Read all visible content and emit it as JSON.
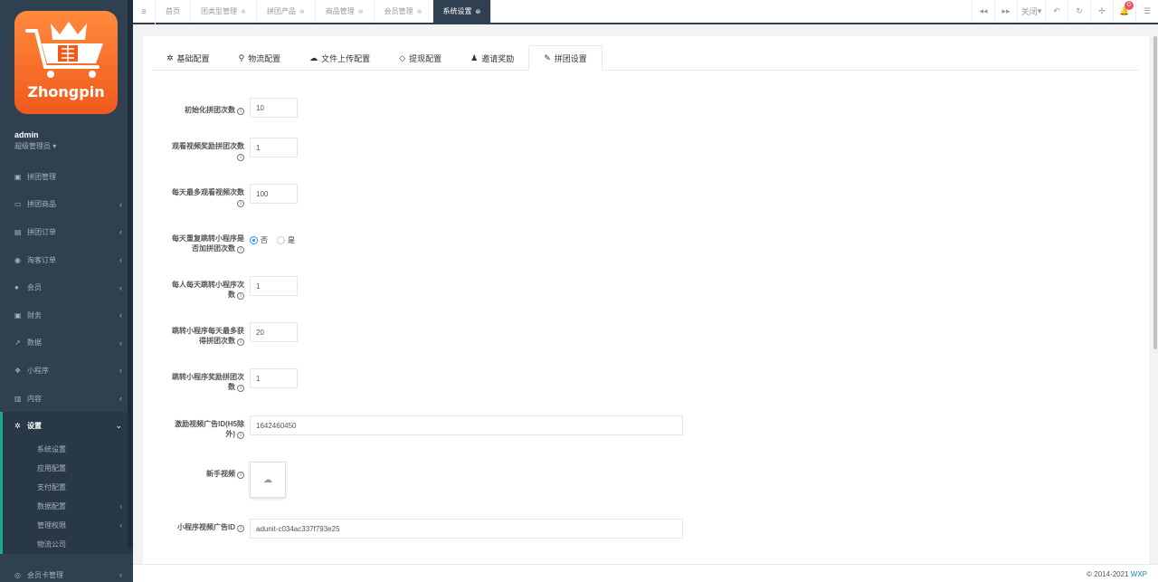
{
  "sidebar": {
    "logo_text": "Zhongpin",
    "user": {
      "name": "admin",
      "role": "超级管理员"
    },
    "items": [
      {
        "label": "拼团管理",
        "icon": "bell-icon",
        "has_arrow": false
      },
      {
        "label": "拼团商品",
        "icon": "laptop-icon",
        "has_arrow": true
      },
      {
        "label": "拼团订单",
        "icon": "list-icon",
        "has_arrow": true
      },
      {
        "label": "淘客订单",
        "icon": "eye-icon",
        "has_arrow": true
      },
      {
        "label": "会员",
        "icon": "user-icon",
        "has_arrow": true
      },
      {
        "label": "财务",
        "icon": "money-icon",
        "has_arrow": true
      },
      {
        "label": "数据",
        "icon": "chart-icon",
        "has_arrow": true
      },
      {
        "label": "小程序",
        "icon": "cube-icon",
        "has_arrow": true
      },
      {
        "label": "内容",
        "icon": "book-icon",
        "has_arrow": true
      },
      {
        "label": "设置",
        "icon": "gear-icon",
        "has_arrow": true,
        "active": true
      }
    ],
    "sub_items": [
      {
        "label": "系统设置",
        "has_arrow": false
      },
      {
        "label": "应用配置",
        "has_arrow": false
      },
      {
        "label": "支付配置",
        "has_arrow": false
      },
      {
        "label": "数据配置",
        "has_arrow": true
      },
      {
        "label": "管理权限",
        "has_arrow": true
      },
      {
        "label": "物流公司",
        "has_arrow": false
      }
    ],
    "bottom_item": {
      "label": "会员卡管理",
      "icon": "card-icon"
    }
  },
  "topbar": {
    "tabs": [
      {
        "label": "首页",
        "closable": false
      },
      {
        "label": "团类型管理",
        "closable": true
      },
      {
        "label": "拼团产品",
        "closable": true
      },
      {
        "label": "商品管理",
        "closable": true
      },
      {
        "label": "会员管理",
        "closable": true
      },
      {
        "label": "系统设置",
        "closable": true,
        "active": true
      }
    ],
    "close_label": "关闭",
    "notification_count": "0"
  },
  "content": {
    "tabs": [
      {
        "label": "基础配置",
        "icon": "gear-icon"
      },
      {
        "label": "物流配置",
        "icon": "motorcycle-icon"
      },
      {
        "label": "文件上传配置",
        "icon": "cloud-upload-icon"
      },
      {
        "label": "提现配置",
        "icon": "diamond-icon"
      },
      {
        "label": "邀请奖励",
        "icon": "user-secret-icon"
      },
      {
        "label": "拼团设置",
        "icon": "brush-icon",
        "active": true
      }
    ],
    "form": {
      "init_count": {
        "label": "初始化拼团次数",
        "value": "10"
      },
      "video_reward": {
        "label": "观看视频奖励拼团次数",
        "value": "1"
      },
      "max_video": {
        "label": "每天最多观看视频次数",
        "value": "100"
      },
      "repeat_jump": {
        "label": "每天重复跳转小程序是否加拼团次数",
        "options": [
          "否",
          "是"
        ],
        "selected": "否"
      },
      "daily_jump": {
        "label": "每人每天跳转小程序次数",
        "value": "1"
      },
      "max_jump_reward": {
        "label": "跳转小程序每天最多获得拼团次数",
        "value": "20"
      },
      "jump_reward": {
        "label": "跳转小程序奖励拼团次数",
        "value": "1"
      },
      "ad_id": {
        "label": "激励视频广告ID(H5除外)",
        "value": "1642460450"
      },
      "novice_video": {
        "label": "新手视频"
      },
      "mp_ad_id": {
        "label": "小程序视频广告ID",
        "value": "adunit-c034ac337f793e25"
      }
    }
  },
  "footer": {
    "copyright": "© 2014-2021",
    "brand": "WXP"
  }
}
